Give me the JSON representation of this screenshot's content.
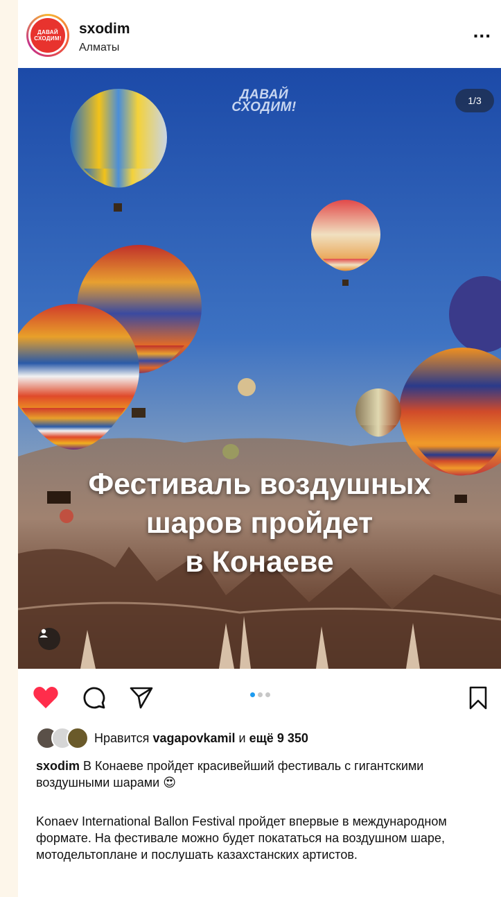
{
  "header": {
    "username": "sxodim",
    "location": "Алматы",
    "avatar_text_1": "ДАВАЙ",
    "avatar_text_2": "СХОДИМ!",
    "more_label": "..."
  },
  "photo": {
    "brand_line_1": "ДАВАЙ",
    "brand_line_2": "СХОДИМ!",
    "counter": "1/3",
    "headline_1": "Фестиваль воздушных",
    "headline_2": "шаров пройдет",
    "headline_3": "в Конаеве"
  },
  "actions": {
    "liked": true,
    "like_color": "#ff2d4b",
    "active_dot_color": "#1d9bf0",
    "carousel_total": 3,
    "carousel_current": 1
  },
  "likes": {
    "prefix": "Нравится",
    "user": "vagapovkamil",
    "and": "и",
    "others": "ещё 9 350"
  },
  "caption": {
    "author": "sxodim",
    "text": "В Конаеве пройдет красивейший фестиваль с гигантскими воздушными шарами",
    "emoji": "😍",
    "paragraph": "Konaev International Ballon Festival пройдет впервые в международном формате. На фестивале можно будет покататься на воздушном шаре, мотодельтоплане и послушать казахстанских артистов."
  },
  "icons": [
    "more-icon",
    "heart-icon",
    "comment-icon",
    "share-icon",
    "bookmark-icon",
    "tagged-user-icon"
  ]
}
